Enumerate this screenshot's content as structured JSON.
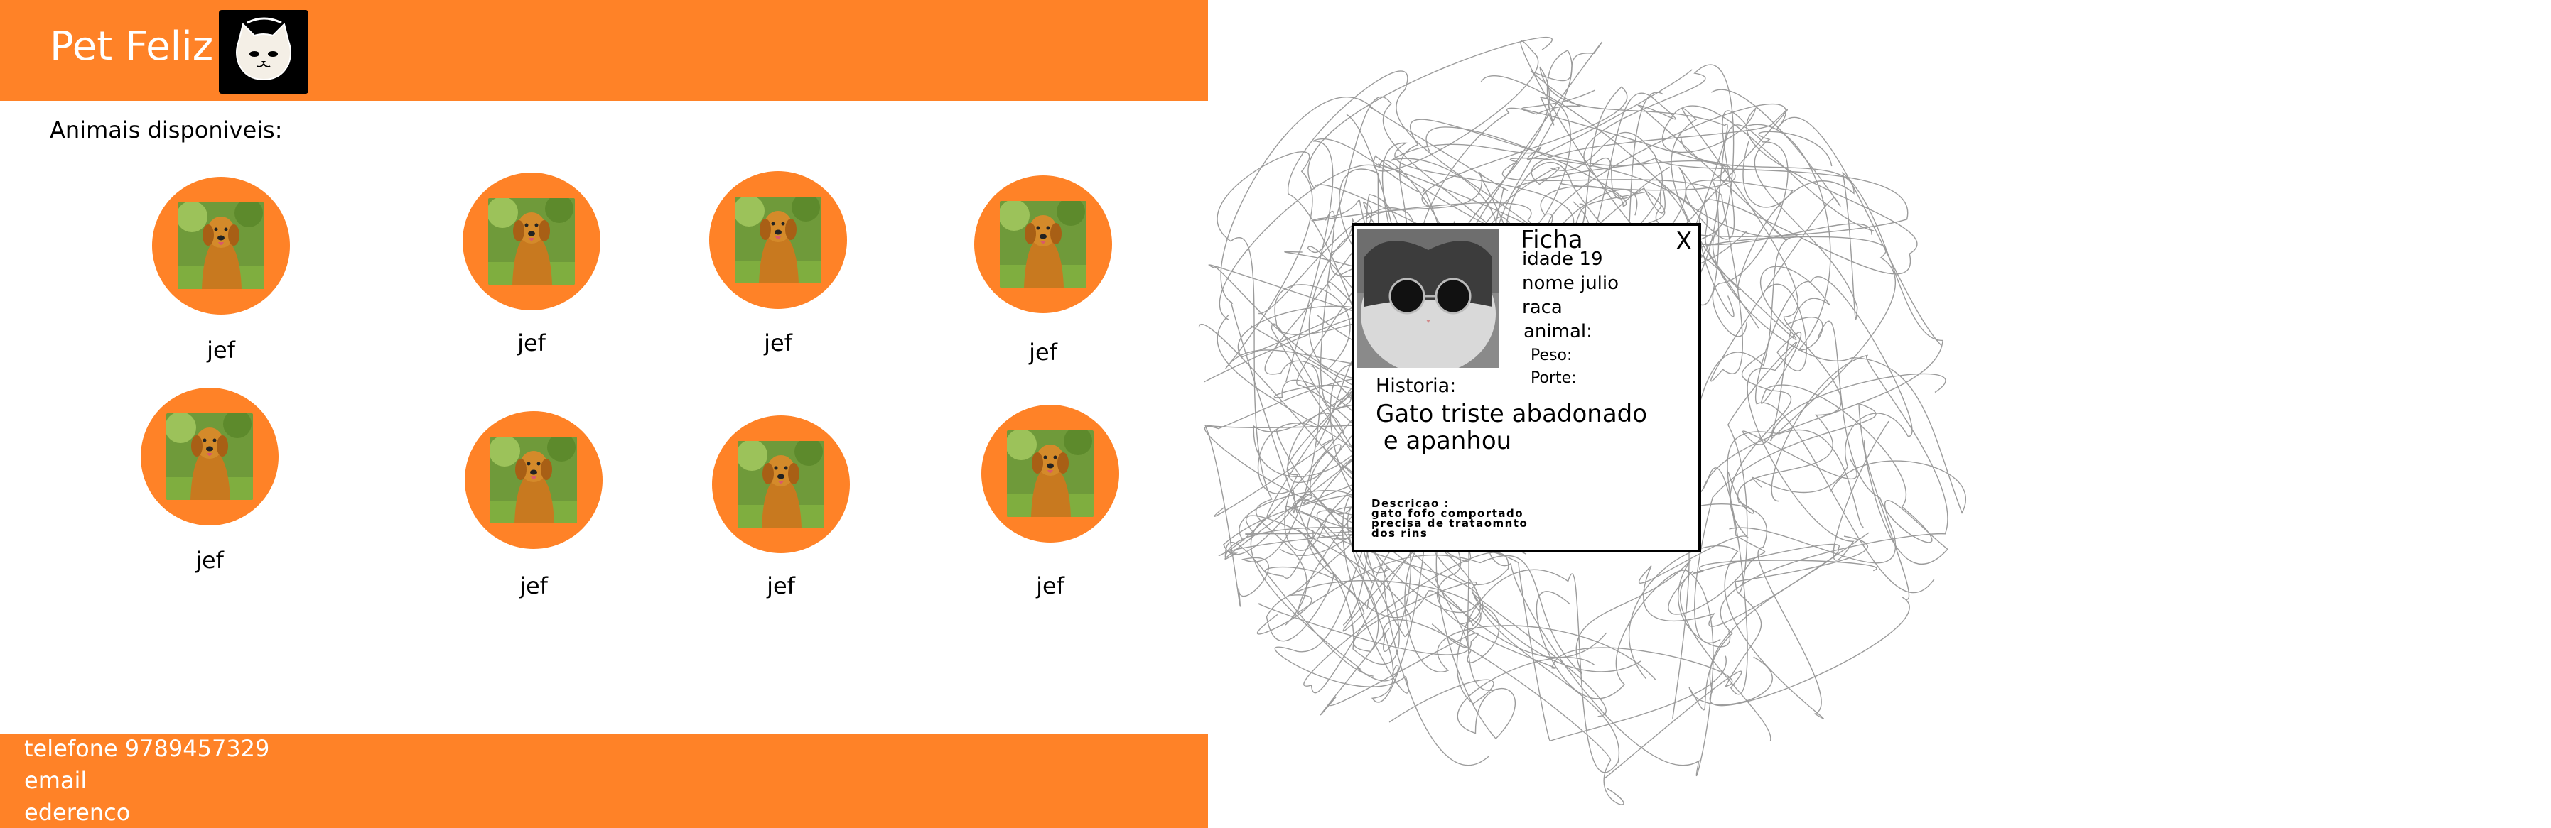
{
  "header": {
    "brand": "Pet Feliz",
    "logo_icon": "cat-face-icon",
    "color": "#FF8227"
  },
  "section_title": "Animais disponiveis:",
  "animals": [
    {
      "name": "jef"
    },
    {
      "name": "jef"
    },
    {
      "name": "jef"
    },
    {
      "name": "jef"
    },
    {
      "name": "jef"
    },
    {
      "name": "jef"
    },
    {
      "name": "jef"
    },
    {
      "name": "jef"
    }
  ],
  "footer": {
    "telefone": "telefone 9789457329",
    "email": "email",
    "endereco": "ederenco"
  },
  "ficha": {
    "title": "Ficha",
    "close": "X",
    "idade": "idade 19",
    "nome": "nome julio",
    "raca": "raca",
    "animal": "animal:",
    "peso": "Peso:",
    "porte": "Porte:",
    "historia_label": "Historia:",
    "historia_line1": "Gato triste abadonado",
    "historia_line2": " e apanhou",
    "descricao_label": "Descricao :",
    "descricao_line1": "gato fofo comportado",
    "descricao_line2": "precisa de trataomnto",
    "descricao_line3": "dos rins"
  }
}
